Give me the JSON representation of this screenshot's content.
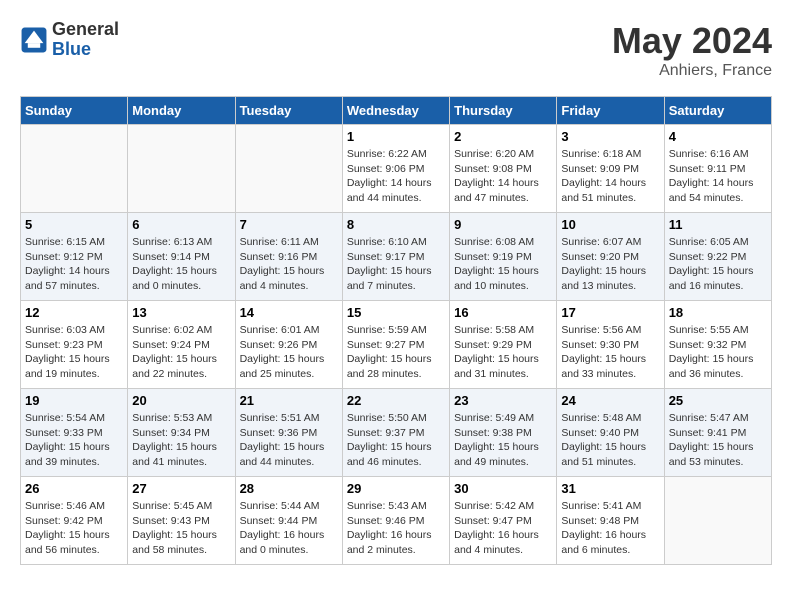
{
  "header": {
    "logo_text_general": "General",
    "logo_text_blue": "Blue",
    "month": "May 2024",
    "location": "Anhiers, France"
  },
  "weekdays": [
    "Sunday",
    "Monday",
    "Tuesday",
    "Wednesday",
    "Thursday",
    "Friday",
    "Saturday"
  ],
  "weeks": [
    {
      "days": [
        null,
        null,
        null,
        {
          "number": "1",
          "sunrise": "Sunrise: 6:22 AM",
          "sunset": "Sunset: 9:06 PM",
          "daylight": "Daylight: 14 hours and 44 minutes."
        },
        {
          "number": "2",
          "sunrise": "Sunrise: 6:20 AM",
          "sunset": "Sunset: 9:08 PM",
          "daylight": "Daylight: 14 hours and 47 minutes."
        },
        {
          "number": "3",
          "sunrise": "Sunrise: 6:18 AM",
          "sunset": "Sunset: 9:09 PM",
          "daylight": "Daylight: 14 hours and 51 minutes."
        },
        {
          "number": "4",
          "sunrise": "Sunrise: 6:16 AM",
          "sunset": "Sunset: 9:11 PM",
          "daylight": "Daylight: 14 hours and 54 minutes."
        }
      ]
    },
    {
      "days": [
        {
          "number": "5",
          "sunrise": "Sunrise: 6:15 AM",
          "sunset": "Sunset: 9:12 PM",
          "daylight": "Daylight: 14 hours and 57 minutes."
        },
        {
          "number": "6",
          "sunrise": "Sunrise: 6:13 AM",
          "sunset": "Sunset: 9:14 PM",
          "daylight": "Daylight: 15 hours and 0 minutes."
        },
        {
          "number": "7",
          "sunrise": "Sunrise: 6:11 AM",
          "sunset": "Sunset: 9:16 PM",
          "daylight": "Daylight: 15 hours and 4 minutes."
        },
        {
          "number": "8",
          "sunrise": "Sunrise: 6:10 AM",
          "sunset": "Sunset: 9:17 PM",
          "daylight": "Daylight: 15 hours and 7 minutes."
        },
        {
          "number": "9",
          "sunrise": "Sunrise: 6:08 AM",
          "sunset": "Sunset: 9:19 PM",
          "daylight": "Daylight: 15 hours and 10 minutes."
        },
        {
          "number": "10",
          "sunrise": "Sunrise: 6:07 AM",
          "sunset": "Sunset: 9:20 PM",
          "daylight": "Daylight: 15 hours and 13 minutes."
        },
        {
          "number": "11",
          "sunrise": "Sunrise: 6:05 AM",
          "sunset": "Sunset: 9:22 PM",
          "daylight": "Daylight: 15 hours and 16 minutes."
        }
      ]
    },
    {
      "days": [
        {
          "number": "12",
          "sunrise": "Sunrise: 6:03 AM",
          "sunset": "Sunset: 9:23 PM",
          "daylight": "Daylight: 15 hours and 19 minutes."
        },
        {
          "number": "13",
          "sunrise": "Sunrise: 6:02 AM",
          "sunset": "Sunset: 9:24 PM",
          "daylight": "Daylight: 15 hours and 22 minutes."
        },
        {
          "number": "14",
          "sunrise": "Sunrise: 6:01 AM",
          "sunset": "Sunset: 9:26 PM",
          "daylight": "Daylight: 15 hours and 25 minutes."
        },
        {
          "number": "15",
          "sunrise": "Sunrise: 5:59 AM",
          "sunset": "Sunset: 9:27 PM",
          "daylight": "Daylight: 15 hours and 28 minutes."
        },
        {
          "number": "16",
          "sunrise": "Sunrise: 5:58 AM",
          "sunset": "Sunset: 9:29 PM",
          "daylight": "Daylight: 15 hours and 31 minutes."
        },
        {
          "number": "17",
          "sunrise": "Sunrise: 5:56 AM",
          "sunset": "Sunset: 9:30 PM",
          "daylight": "Daylight: 15 hours and 33 minutes."
        },
        {
          "number": "18",
          "sunrise": "Sunrise: 5:55 AM",
          "sunset": "Sunset: 9:32 PM",
          "daylight": "Daylight: 15 hours and 36 minutes."
        }
      ]
    },
    {
      "days": [
        {
          "number": "19",
          "sunrise": "Sunrise: 5:54 AM",
          "sunset": "Sunset: 9:33 PM",
          "daylight": "Daylight: 15 hours and 39 minutes."
        },
        {
          "number": "20",
          "sunrise": "Sunrise: 5:53 AM",
          "sunset": "Sunset: 9:34 PM",
          "daylight": "Daylight: 15 hours and 41 minutes."
        },
        {
          "number": "21",
          "sunrise": "Sunrise: 5:51 AM",
          "sunset": "Sunset: 9:36 PM",
          "daylight": "Daylight: 15 hours and 44 minutes."
        },
        {
          "number": "22",
          "sunrise": "Sunrise: 5:50 AM",
          "sunset": "Sunset: 9:37 PM",
          "daylight": "Daylight: 15 hours and 46 minutes."
        },
        {
          "number": "23",
          "sunrise": "Sunrise: 5:49 AM",
          "sunset": "Sunset: 9:38 PM",
          "daylight": "Daylight: 15 hours and 49 minutes."
        },
        {
          "number": "24",
          "sunrise": "Sunrise: 5:48 AM",
          "sunset": "Sunset: 9:40 PM",
          "daylight": "Daylight: 15 hours and 51 minutes."
        },
        {
          "number": "25",
          "sunrise": "Sunrise: 5:47 AM",
          "sunset": "Sunset: 9:41 PM",
          "daylight": "Daylight: 15 hours and 53 minutes."
        }
      ]
    },
    {
      "days": [
        {
          "number": "26",
          "sunrise": "Sunrise: 5:46 AM",
          "sunset": "Sunset: 9:42 PM",
          "daylight": "Daylight: 15 hours and 56 minutes."
        },
        {
          "number": "27",
          "sunrise": "Sunrise: 5:45 AM",
          "sunset": "Sunset: 9:43 PM",
          "daylight": "Daylight: 15 hours and 58 minutes."
        },
        {
          "number": "28",
          "sunrise": "Sunrise: 5:44 AM",
          "sunset": "Sunset: 9:44 PM",
          "daylight": "Daylight: 16 hours and 0 minutes."
        },
        {
          "number": "29",
          "sunrise": "Sunrise: 5:43 AM",
          "sunset": "Sunset: 9:46 PM",
          "daylight": "Daylight: 16 hours and 2 minutes."
        },
        {
          "number": "30",
          "sunrise": "Sunrise: 5:42 AM",
          "sunset": "Sunset: 9:47 PM",
          "daylight": "Daylight: 16 hours and 4 minutes."
        },
        {
          "number": "31",
          "sunrise": "Sunrise: 5:41 AM",
          "sunset": "Sunset: 9:48 PM",
          "daylight": "Daylight: 16 hours and 6 minutes."
        },
        null
      ]
    }
  ]
}
